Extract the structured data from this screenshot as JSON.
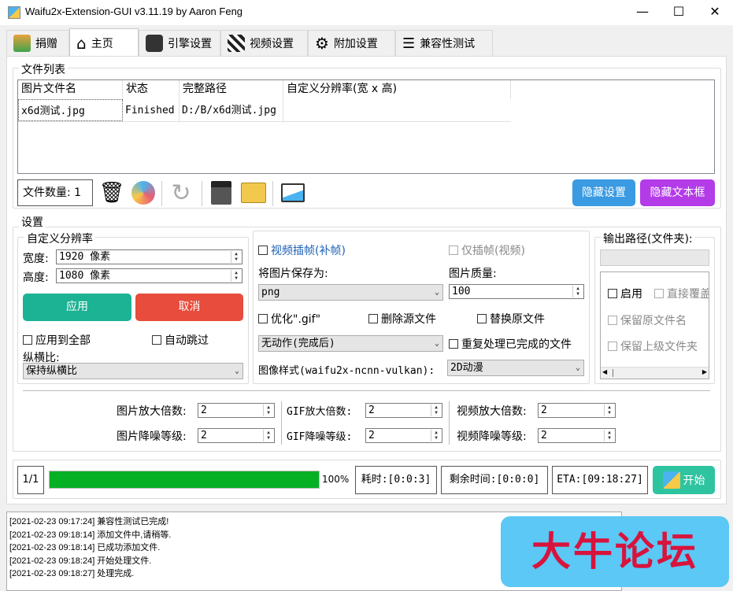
{
  "window": {
    "title": "Waifu2x-Extension-GUI v3.11.19 by Aaron Feng",
    "minimize": "—",
    "maximize": "☐",
    "close": "✕"
  },
  "tabs": [
    {
      "label": "捐赠",
      "icon": "donate-icon"
    },
    {
      "label": "主页",
      "icon": "home-icon"
    },
    {
      "label": "引擎设置",
      "icon": "engine-icon"
    },
    {
      "label": "视频设置",
      "icon": "clapperboard-icon"
    },
    {
      "label": "附加设置",
      "icon": "gear-icon"
    },
    {
      "label": "兼容性测试",
      "icon": "checklist-icon"
    }
  ],
  "file_list": {
    "title": "文件列表",
    "columns": [
      "图片文件名",
      "状态",
      "完整路径",
      "自定义分辨率(宽 x 高)"
    ],
    "rows": [
      {
        "name": "x6d测试.jpg",
        "status": "Finished",
        "path": "D:/B/x6d测试.jpg",
        "res": ""
      }
    ],
    "file_count": "文件数量: 1",
    "hide_settings": "隐藏设置",
    "hide_textbox": "隐藏文本框"
  },
  "settings": {
    "title": "设置",
    "custom_res": {
      "title": "自定义分辨率",
      "width_label": "宽度:",
      "width_value": "1920 像素",
      "height_label": "高度:",
      "height_value": "1080 像素",
      "apply": "应用",
      "cancel": "取消",
      "apply_all": "应用到全部",
      "auto_skip": "自动跳过",
      "aspect_label": "纵横比:",
      "aspect_value": "保持纵横比"
    },
    "video_interp": "视频插帧(补帧)",
    "interp_only": "仅插帧(视频)",
    "save_as_label": "将图片保存为:",
    "save_as_value": "png",
    "quality_label": "图片质量:",
    "quality_value": "100",
    "optimize_gif": "优化\".gif\"",
    "delete_source": "删除源文件",
    "replace_original": "替换原文件",
    "no_anim_value": "无动作(完成后)",
    "reprocess": "重复处理已完成的文件",
    "style_label": "图像样式(waifu2x-ncnn-vulkan):",
    "style_value": "2D动漫",
    "output": {
      "title": "输出路径(文件夹):",
      "enable": "启用",
      "overwrite": "直接覆盖",
      "keep_name": "保留原文件名",
      "keep_parent": "保留上级文件夹"
    }
  },
  "scale": {
    "img_scale_label": "图片放大倍数:",
    "img_scale": "2",
    "img_denoise_label": "图片降噪等级:",
    "img_denoise": "2",
    "gif_scale_label": "GIF放大倍数:",
    "gif_scale": "2",
    "gif_denoise_label": "GIF降噪等级:",
    "gif_denoise": "2",
    "vid_scale_label": "视频放大倍数:",
    "vid_scale": "2",
    "vid_denoise_label": "视频降噪等级:",
    "vid_denoise": "2"
  },
  "progress": {
    "count": "1/1",
    "percent": 100,
    "percent_text": "100%",
    "elapsed": "耗时:[0:0:3]",
    "remaining": "剩余时间:[0:0:0]",
    "eta": "ETA:[09:18:27]",
    "start": "开始"
  },
  "log": [
    "[2021-02-23 09:17:24] 兼容性测试已完成!",
    "[2021-02-23 09:18:14] 添加文件中,请稍等.",
    "[2021-02-23 09:18:14] 已成功添加文件.",
    "[2021-02-23 09:18:24] 开始处理文件.",
    "[2021-02-23 09:18:27] 处理完成."
  ],
  "watermark": "大牛论坛",
  "colors": {
    "green": "#1bb394",
    "red": "#e74c3c",
    "blue": "#3a9ae2",
    "purple": "#b33be8",
    "progress": "#06b025",
    "start": "#2ec4a0"
  }
}
